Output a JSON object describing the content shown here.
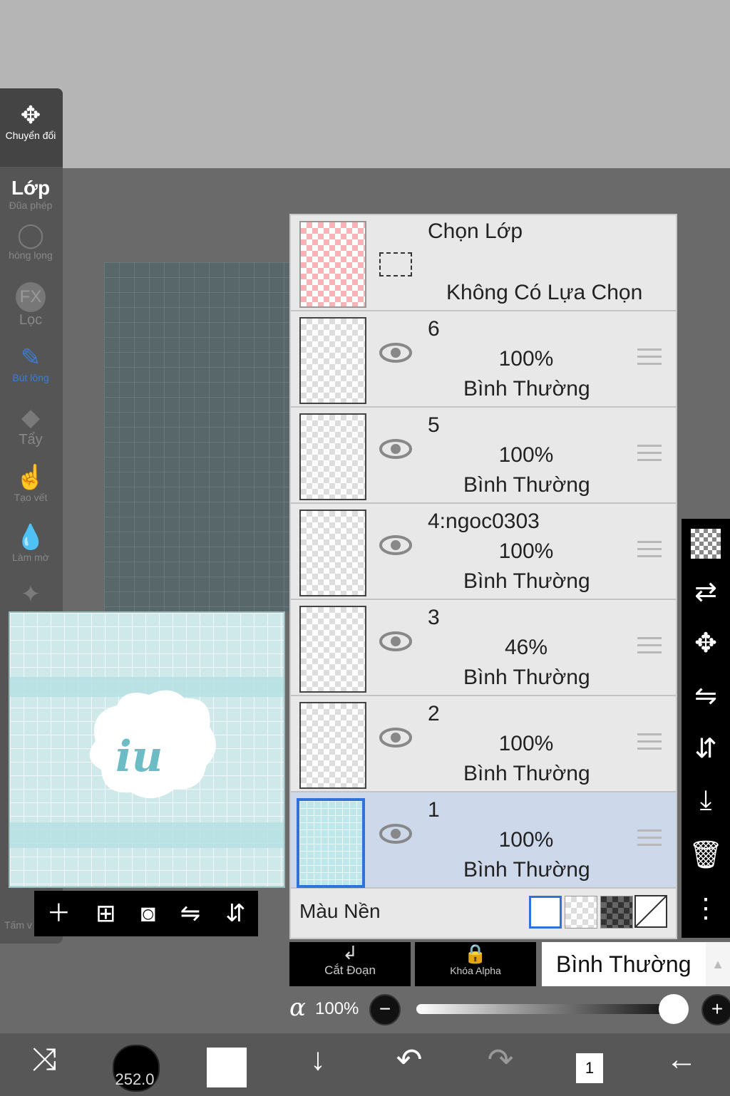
{
  "left_toolbar": {
    "transform_label": "Chuyển đổi",
    "layer_label": "Lớp",
    "magic_wand_label": "Đũa phép",
    "lasso_label": "hòng lọng",
    "filter_icon_text": "FX",
    "filter_label": "Lọc",
    "brush_label": "Bút lông",
    "eraser_label": "Tẩy",
    "smudge_label": "Tạo vết",
    "blur_label": "Làm mờ",
    "canvas_label": "Tấm v"
  },
  "layers": {
    "selection_title": "Chọn Lớp",
    "selection_status": "Không Có Lựa Chọn",
    "items": [
      {
        "name": "6",
        "opacity": "100%",
        "mode": "Bình Thường"
      },
      {
        "name": "5",
        "opacity": "100%",
        "mode": "Bình Thường"
      },
      {
        "name": "4:ngoc0303",
        "opacity": "100%",
        "mode": "Bình Thường"
      },
      {
        "name": "3",
        "opacity": "46%",
        "mode": "Bình Thường"
      },
      {
        "name": "2",
        "opacity": "100%",
        "mode": "Bình Thường"
      },
      {
        "name": "1",
        "opacity": "100%",
        "mode": "Bình Thường",
        "selected": true
      }
    ],
    "background_color_label": "Màu Nền"
  },
  "bottom_controls": {
    "clip_label": "Cắt Đoạn",
    "alpha_lock_label": "Khóa Alpha",
    "blend_mode": "Bình Thường",
    "alpha_symbol": "α",
    "opacity_value": "100%"
  },
  "bottom_bar": {
    "brush_size": "252.0",
    "layer_count": "1"
  },
  "colors": {
    "accent": "#2f73d8",
    "selected_row": "#cdd9ea",
    "panel_bg": "#e6e6e6"
  }
}
